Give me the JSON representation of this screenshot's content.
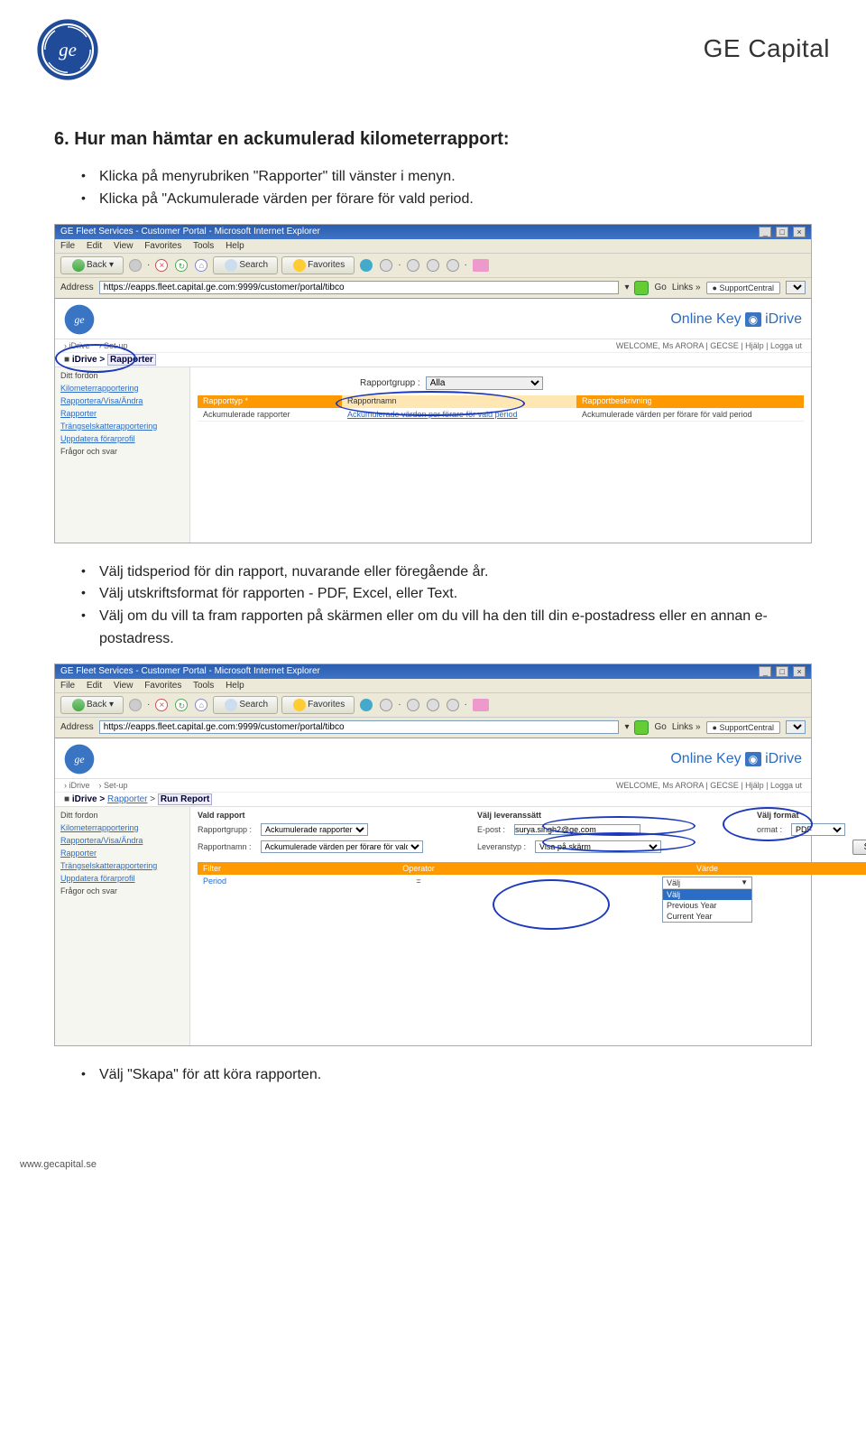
{
  "header": {
    "brand": "GE Capital"
  },
  "section": {
    "heading": "6. Hur man hämtar en ackumulerad kilometerrapport:",
    "bullets_top": [
      "Klicka på menyrubriken \"Rapporter\" till vänster i menyn.",
      "Klicka på \"Ackumulerade värden per förare för vald period."
    ],
    "bullets_mid": [
      "Välj tidsperiod för din rapport, nuvarande eller föregående år.",
      "Välj utskriftsformat för rapporten - PDF, Excel, eller Text.",
      "Välj om du vill ta fram rapporten på skärmen eller om du vill ha den till din e-postadress eller en annan e-postadress."
    ],
    "bullets_bottom": [
      "Välj \"Skapa\" för att köra rapporten."
    ]
  },
  "shot_common": {
    "title": "GE Fleet Services - Customer Portal - Microsoft Internet Explorer",
    "menubar": [
      "File",
      "Edit",
      "View",
      "Favorites",
      "Tools",
      "Help"
    ],
    "back": "Back",
    "search": "Search",
    "favorites": "Favorites",
    "address_label": "Address",
    "address_value": "https://eapps.fleet.capital.ge.com:9999/customer/portal/tibco",
    "go_label": "Go",
    "links_label": "Links »",
    "support_central": "SupportCentral",
    "online_key": "Online Key",
    "idrive": "iDrive",
    "welcome": "WELCOME, Ms ARORA | GECSE | Hjälp | Logga ut",
    "tabs": {
      "idrive": "iDrive",
      "setup": "Set-up"
    },
    "sidemenu": {
      "top": "Ditt fordon",
      "items": [
        "Kilometerrapportering",
        "Rapportera/Visa/Ändra",
        "Rapporter",
        "Trängselskatterapportering",
        "Uppdatera förarprofil",
        "Frågor och svar"
      ]
    }
  },
  "shot1": {
    "breadcrumb_prefix": "iDrive >",
    "breadcrumb_current": "Rapporter",
    "rg_label": "Rapportgrupp :",
    "rg_value": "Alla",
    "cols": {
      "a": "Rapporttyp *",
      "b": "Rapportnamn",
      "c": "Rapportbeskrivning"
    },
    "row": {
      "a": "Ackumulerade rapporter",
      "b": "Ackumulerade värden per förare för vald period",
      "c": "Ackumulerade värden per förare för vald period"
    }
  },
  "shot2": {
    "breadcrumb_prefix": "iDrive >",
    "breadcrumb_mid": "Rapporter",
    "breadcrumb_current": "Run Report",
    "form": {
      "vald_rapport": "Vald rapport",
      "leveranssatt": "Välj leveranssätt",
      "valj_format": "Välj format",
      "rapportgrupp_lbl": "Rapportgrupp :",
      "rapportgrupp_val": "Ackumulerade rapporter",
      "rapportnamn_lbl": "Rapportnamn :",
      "rapportnamn_val": "Ackumulerade värden per förare för vald",
      "epost_lbl": "E-post :",
      "epost_val": "surya.singh2@ge.com",
      "leveranstyp_lbl": "Leveranstyp :",
      "leveranstyp_val": "Visa på skärm",
      "format_lbl": "ormat :",
      "format_val": "PDF",
      "create": "Skapa"
    },
    "filterbar": {
      "a": "Filter",
      "b": "Operator",
      "c": "Värde"
    },
    "filterrow": {
      "label": "Period",
      "op": "=",
      "sel": "Välj",
      "opts": [
        "Välj",
        "Previous Year",
        "Current Year"
      ]
    }
  },
  "footer": {
    "url": "www.gecapital.se"
  }
}
